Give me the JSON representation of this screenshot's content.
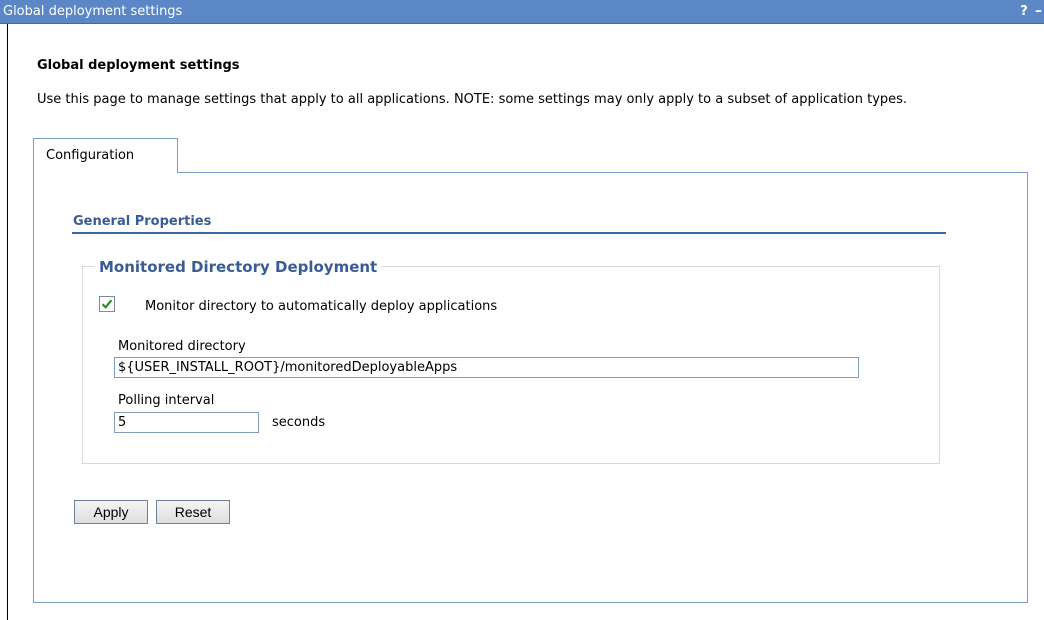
{
  "window": {
    "title": "Global deployment settings",
    "help_glyph": "?",
    "minimize_glyph": "–"
  },
  "page": {
    "title": "Global deployment settings",
    "description": "Use this page to manage settings that apply to all applications. NOTE: some settings may only apply to a subset of application types."
  },
  "tabs": [
    {
      "label": "Configuration",
      "selected": true
    }
  ],
  "general_properties": {
    "title": "General Properties"
  },
  "monitored_deployment": {
    "legend": "Monitored Directory Deployment",
    "monitor_checkbox": {
      "label": "Monitor directory to automatically deploy applications",
      "checked": true
    },
    "directory": {
      "label": "Monitored directory",
      "value": "${USER_INSTALL_ROOT}/monitoredDeployableApps"
    },
    "polling": {
      "label": "Polling interval",
      "value": "5",
      "unit": "seconds"
    }
  },
  "buttons": {
    "apply": "Apply",
    "reset": "Reset"
  },
  "colors": {
    "titlebar": "#5b87c6",
    "section_text": "#3a5c94",
    "checkmark": "#2e8b2e"
  }
}
